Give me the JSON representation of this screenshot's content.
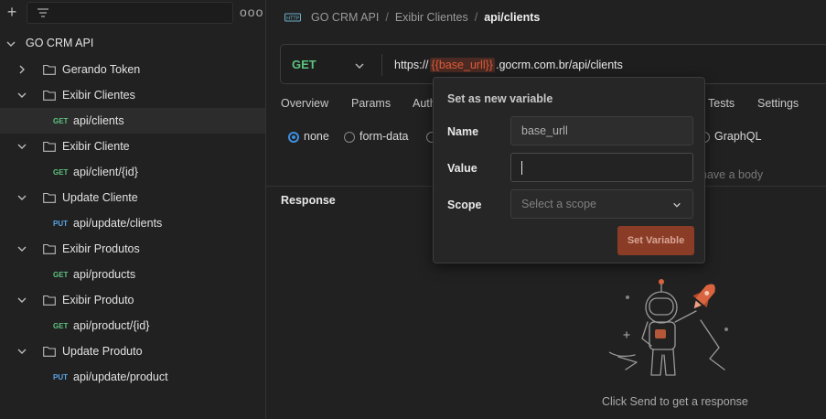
{
  "sidebar": {
    "new_icon": "plus-icon",
    "filter_icon": "filter-icon",
    "more_label": "ooo",
    "collection": {
      "name": "GO CRM API"
    },
    "items": [
      {
        "type": "folder",
        "label": "Gerando Token"
      },
      {
        "type": "folder",
        "label": "Exibir Clientes"
      },
      {
        "type": "request",
        "method": "GET",
        "label": "api/clients"
      },
      {
        "type": "folder",
        "label": "Exibir Cliente"
      },
      {
        "type": "request",
        "method": "GET",
        "label": "api/client/{id}"
      },
      {
        "type": "folder",
        "label": "Update Cliente"
      },
      {
        "type": "request",
        "method": "PUT",
        "label": "api/update/clients"
      },
      {
        "type": "folder",
        "label": "Exibir Produtos"
      },
      {
        "type": "request",
        "method": "GET",
        "label": "api/products"
      },
      {
        "type": "folder",
        "label": "Exibir Produto"
      },
      {
        "type": "request",
        "method": "GET",
        "label": "api/product/{id}"
      },
      {
        "type": "folder",
        "label": "Update Produto"
      },
      {
        "type": "request",
        "method": "PUT",
        "label": "api/update/product"
      }
    ]
  },
  "breadcrumb": {
    "icon": "http-icon",
    "parts": [
      "GO CRM API",
      "Exibir Clientes"
    ],
    "current": "api/clients"
  },
  "request": {
    "method": "GET",
    "url_prefix": "https://",
    "url_variable": "{{base_urll}}",
    "url_suffix": ".gocrm.com.br/api/clients"
  },
  "tabs": [
    "Overview",
    "Params",
    "Auth",
    "Tests",
    "Settings"
  ],
  "body_options": [
    "none",
    "form-data",
    "GraphQL"
  ],
  "body_hint": "have a body",
  "response": {
    "title": "Response",
    "empty_hint": "Click Send to get a response"
  },
  "popover": {
    "title": "Set as new variable",
    "name_label": "Name",
    "name_value": "base_urll",
    "value_label": "Value",
    "value_value": "",
    "scope_label": "Scope",
    "scope_placeholder": "Select a scope",
    "button": "Set Variable"
  },
  "colors": {
    "accent": "#e05a3a",
    "get": "#5ec27f",
    "put": "#5aa5e6",
    "radio": "#3d8fe0"
  }
}
